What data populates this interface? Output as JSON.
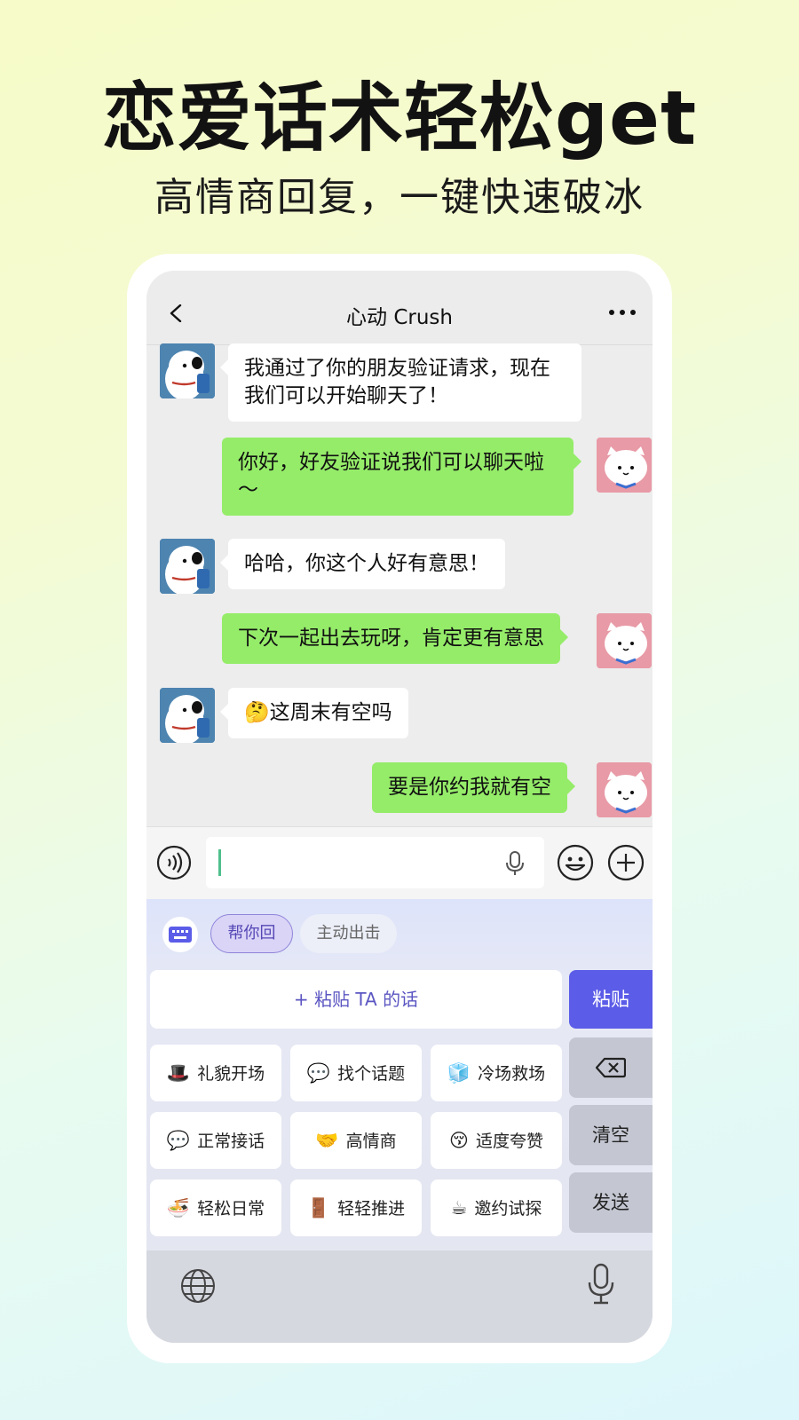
{
  "headline": "恋爱话术轻松get",
  "subhead": "高情商回复，一键快速破冰",
  "nav": {
    "title": "心动 Crush",
    "back_icon": "chevron-left-icon",
    "more_icon": "more-dots-icon"
  },
  "messages": [
    {
      "side": "in",
      "text": "我通过了你的朋友验证请求，现在我们可以开始聊天了！"
    },
    {
      "side": "out",
      "text": "你好，好友验证说我们可以聊天啦～"
    },
    {
      "side": "in",
      "text": "哈哈，你这个人好有意思！"
    },
    {
      "side": "out",
      "text": "下次一起出去玩呀，肯定更有意思"
    },
    {
      "side": "in",
      "text": "🤔这周末有空吗"
    },
    {
      "side": "out",
      "text": "要是你约我就有空"
    }
  ],
  "input": {
    "value": "",
    "placeholder": ""
  },
  "keyboard": {
    "tabs": {
      "active": "帮你回",
      "inactive": "主动出击"
    },
    "paste_field": "+ 粘贴 TA 的话",
    "paste_button": "粘贴",
    "chips": [
      {
        "emoji": "🎩",
        "label": "礼貌开场"
      },
      {
        "emoji": "💬",
        "label": "找个话题"
      },
      {
        "emoji": "🧊",
        "label": "冷场救场"
      },
      {
        "emoji": "💬",
        "label": "正常接话"
      },
      {
        "emoji": "🤝",
        "label": "高情商"
      },
      {
        "emoji": "😚",
        "label": "适度夸赞"
      },
      {
        "emoji": "🍜",
        "label": "轻松日常"
      },
      {
        "emoji": "🚪",
        "label": "轻轻推进"
      },
      {
        "emoji": "☕",
        "label": "邀约试探"
      }
    ],
    "side_keys": {
      "delete_icon": "backspace-icon",
      "clear": "清空",
      "send": "发送"
    }
  },
  "colors": {
    "outgoing_bubble": "#95ec69",
    "accent": "#5b5ce8"
  }
}
